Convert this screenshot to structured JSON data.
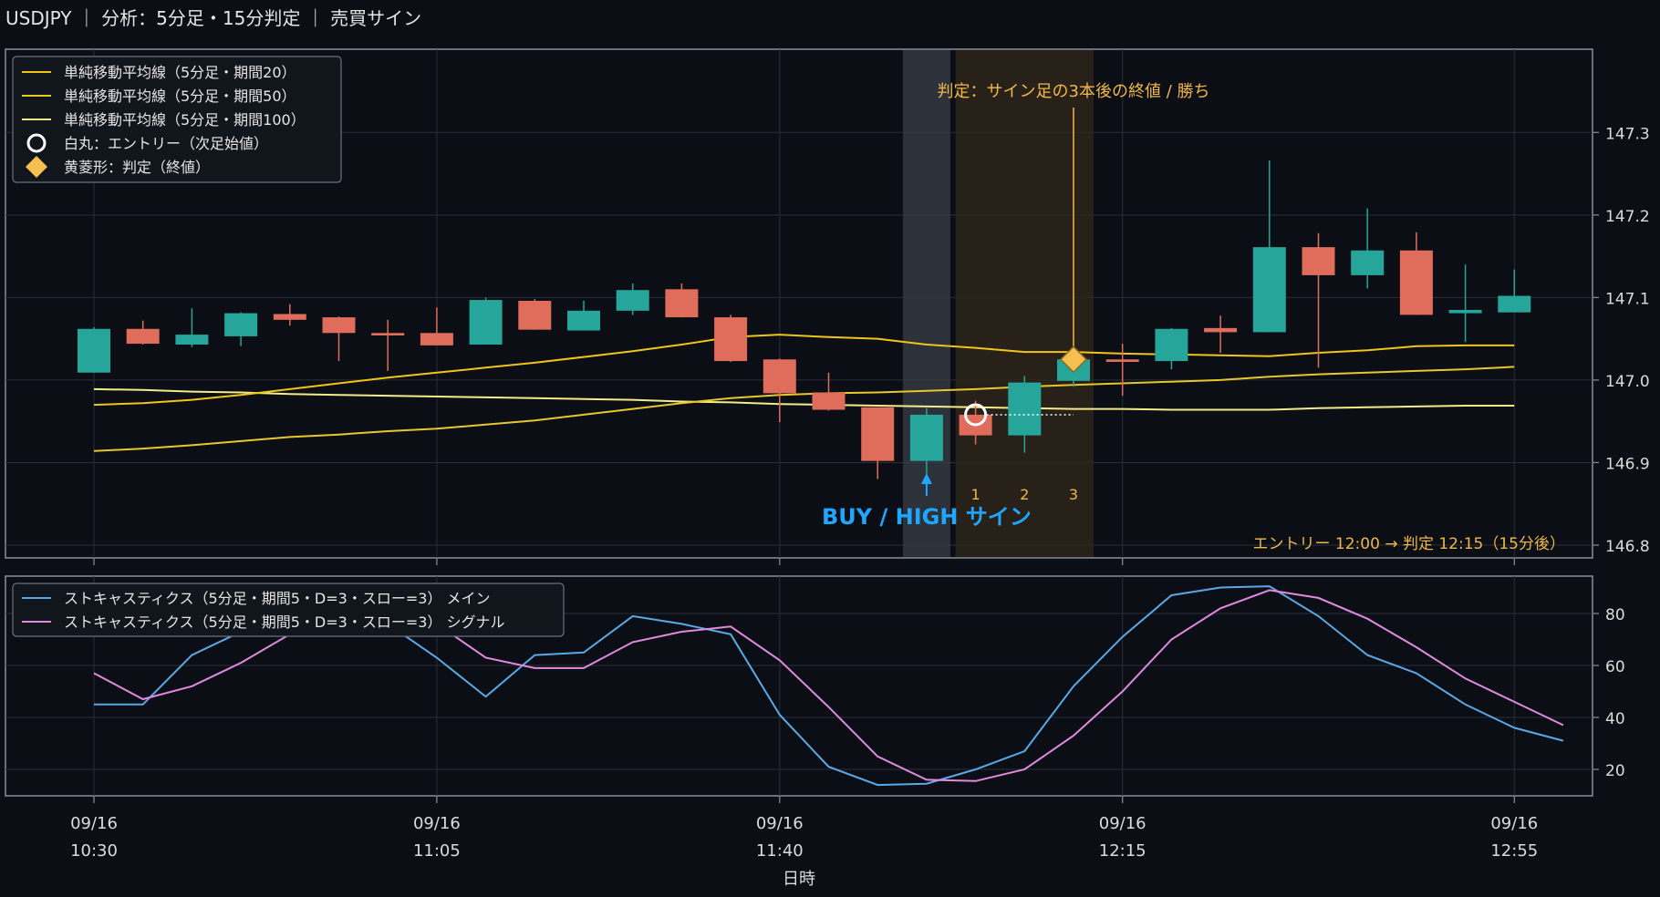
{
  "title": "USDJPY ｜ 分析：5分足・15分判定 ｜ 売買サイン",
  "colors": {
    "background": "#0b0e14",
    "panel_border": "#8a8f99",
    "grid": "#2a2e37",
    "bull": "#26a69a",
    "bear": "#e06c5c",
    "sma20": "#f0c419",
    "sma50": "#e8c72a",
    "sma100": "#f3ea8a",
    "judge_marker": "#f6bf4f",
    "sign_text": "#1fa6ff",
    "stoch_main": "#5aa9e6",
    "stoch_signal": "#e28adf",
    "annotation": "#f0b84a"
  },
  "chart_data": [
    {
      "type": "candlestick",
      "symbol": "USDJPY",
      "timeframe": "5分足",
      "ylim": [
        146.8,
        147.35
      ],
      "yticks": [
        146.8,
        146.9,
        147.0,
        147.1,
        147.2,
        147.3
      ],
      "ytick_labels": [
        "146.8",
        "146.9",
        "147.0",
        "147.1",
        "147.2",
        "147.3"
      ],
      "grid": true,
      "legend_position": "top-left",
      "legend": [
        {
          "label": "単純移動平均線（5分足・期間20）",
          "kind": "line",
          "color": "#f0c419"
        },
        {
          "label": "単純移動平均線（5分足・期間50）",
          "kind": "line",
          "color": "#e8c72a"
        },
        {
          "label": "単純移動平均線（5分足・期間100）",
          "kind": "line",
          "color": "#f3ea8a"
        },
        {
          "label": "白丸：エントリー（次足始値）",
          "kind": "circle",
          "color": "#ffffff"
        },
        {
          "label": "黄菱形：判定（終値）",
          "kind": "diamond",
          "color": "#f6bf4f"
        }
      ],
      "times": [
        "10:30",
        "10:35",
        "10:40",
        "10:45",
        "10:50",
        "10:55",
        "11:00",
        "11:05",
        "11:10",
        "11:15",
        "11:20",
        "11:25",
        "11:30",
        "11:35",
        "11:40",
        "11:45",
        "11:50",
        "11:55",
        "12:00",
        "12:05",
        "12:10",
        "12:15",
        "12:20",
        "12:25",
        "12:30",
        "12:35",
        "12:40",
        "12:45",
        "12:50",
        "12:55"
      ],
      "candles": [
        {
          "o": 147.009,
          "h": 147.064,
          "l": 147.009,
          "c": 147.062
        },
        {
          "o": 147.062,
          "h": 147.072,
          "l": 147.043,
          "c": 147.044
        },
        {
          "o": 147.043,
          "h": 147.087,
          "l": 147.04,
          "c": 147.055
        },
        {
          "o": 147.053,
          "h": 147.082,
          "l": 147.041,
          "c": 147.081
        },
        {
          "o": 147.08,
          "h": 147.092,
          "l": 147.066,
          "c": 147.073
        },
        {
          "o": 147.076,
          "h": 147.077,
          "l": 147.023,
          "c": 147.057
        },
        {
          "o": 147.057,
          "h": 147.073,
          "l": 147.011,
          "c": 147.054
        },
        {
          "o": 147.057,
          "h": 147.088,
          "l": 147.042,
          "c": 147.042
        },
        {
          "o": 147.043,
          "h": 147.1,
          "l": 147.043,
          "c": 147.097
        },
        {
          "o": 147.096,
          "h": 147.098,
          "l": 147.061,
          "c": 147.061
        },
        {
          "o": 147.06,
          "h": 147.096,
          "l": 147.06,
          "c": 147.084
        },
        {
          "o": 147.084,
          "h": 147.117,
          "l": 147.079,
          "c": 147.109
        },
        {
          "o": 147.11,
          "h": 147.117,
          "l": 147.076,
          "c": 147.076
        },
        {
          "o": 147.076,
          "h": 147.079,
          "l": 147.022,
          "c": 147.023
        },
        {
          "o": 147.025,
          "h": 147.026,
          "l": 146.949,
          "c": 146.984
        },
        {
          "o": 146.985,
          "h": 147.009,
          "l": 146.963,
          "c": 146.964
        },
        {
          "o": 146.967,
          "h": 146.967,
          "l": 146.88,
          "c": 146.902
        },
        {
          "o": 146.902,
          "h": 146.966,
          "l": 146.886,
          "c": 146.958
        },
        {
          "o": 146.958,
          "h": 146.975,
          "l": 146.922,
          "c": 146.933
        },
        {
          "o": 146.933,
          "h": 147.005,
          "l": 146.912,
          "c": 146.997
        },
        {
          "o": 146.999,
          "h": 147.028,
          "l": 146.992,
          "c": 147.025
        },
        {
          "o": 147.025,
          "h": 147.044,
          "l": 146.981,
          "c": 147.022
        },
        {
          "o": 147.023,
          "h": 147.063,
          "l": 147.013,
          "c": 147.062
        },
        {
          "o": 147.063,
          "h": 147.078,
          "l": 147.033,
          "c": 147.058
        },
        {
          "o": 147.058,
          "h": 147.266,
          "l": 147.058,
          "c": 147.161
        },
        {
          "o": 147.161,
          "h": 147.178,
          "l": 147.015,
          "c": 147.127
        },
        {
          "o": 147.127,
          "h": 147.208,
          "l": 147.111,
          "c": 147.157
        },
        {
          "o": 147.157,
          "h": 147.179,
          "l": 147.079,
          "c": 147.079
        },
        {
          "o": 147.081,
          "h": 147.14,
          "l": 147.046,
          "c": 147.085
        },
        {
          "o": 147.082,
          "h": 147.134,
          "l": 147.082,
          "c": 147.102
        }
      ],
      "sma20": [
        146.97,
        146.972,
        146.976,
        146.982,
        146.989,
        146.996,
        147.003,
        147.009,
        147.015,
        147.021,
        147.028,
        147.035,
        147.043,
        147.052,
        147.055,
        147.052,
        147.05,
        147.043,
        147.039,
        147.034,
        147.034,
        147.032,
        147.031,
        147.03,
        147.029,
        147.033,
        147.036,
        147.041,
        147.042,
        147.042
      ],
      "sma50": [
        146.914,
        146.917,
        146.921,
        146.926,
        146.931,
        146.934,
        146.938,
        146.941,
        146.946,
        146.951,
        146.958,
        146.965,
        146.972,
        146.978,
        146.982,
        146.984,
        146.985,
        146.987,
        146.989,
        146.992,
        146.994,
        146.996,
        146.998,
        147.0,
        147.004,
        147.007,
        147.009,
        147.011,
        147.013,
        147.016
      ],
      "sma100": [
        146.989,
        146.988,
        146.986,
        146.985,
        146.983,
        146.982,
        146.981,
        146.98,
        146.979,
        146.978,
        146.977,
        146.976,
        146.974,
        146.973,
        146.971,
        146.97,
        146.969,
        146.968,
        146.967,
        146.966,
        146.965,
        146.965,
        146.964,
        146.964,
        146.964,
        146.966,
        146.967,
        146.968,
        146.969,
        146.969
      ],
      "signal": {
        "index": 17,
        "text": "BUY / HIGH サイン"
      },
      "entry": {
        "index": 18,
        "price": 146.958,
        "time": "12:00"
      },
      "judge": {
        "index": 20,
        "price": 147.025,
        "time": "12:15"
      },
      "count_labels": [
        "1",
        "2",
        "3"
      ],
      "judge_text": "判定：サイン足の3本後の終値 / 勝ち",
      "entry_judge_text": "エントリー 12:00 → 判定 12:15（15分後）"
    },
    {
      "type": "line",
      "name": "stochastics",
      "ylim": [
        10,
        93
      ],
      "yticks": [
        20,
        40,
        60,
        80
      ],
      "ytick_labels": [
        "20",
        "40",
        "60",
        "80"
      ],
      "grid": true,
      "legend_position": "top-left",
      "series": [
        {
          "name": "ストキャスティクス（5分足・期間5・D=3・スロー=3） メイン",
          "color": "#5aa9e6",
          "values": [
            45,
            45,
            64,
            73,
            76,
            76,
            76,
            63,
            48,
            64,
            65,
            79,
            76,
            72,
            41,
            21,
            14,
            14.5,
            20,
            27,
            52,
            71,
            87,
            90,
            90.5,
            79,
            64,
            57,
            45,
            36,
            31
          ]
        },
        {
          "name": "ストキャスティクス（5分足・期間5・D=3・スロー=3） シグナル",
          "color": "#e28adf",
          "values": [
            57,
            47,
            52,
            61,
            72,
            75,
            75,
            76,
            63,
            59,
            59,
            69,
            73,
            75,
            62,
            44,
            25,
            16,
            15.5,
            20,
            33,
            50,
            70,
            82,
            89,
            86,
            78,
            67,
            55,
            46,
            37
          ]
        }
      ]
    }
  ],
  "x_axis": {
    "label": "日時",
    "ticks": [
      {
        "index": 0,
        "date": "09/16",
        "time": "10:30"
      },
      {
        "index": 7,
        "date": "09/16",
        "time": "11:05"
      },
      {
        "index": 14,
        "date": "09/16",
        "time": "11:40"
      },
      {
        "index": 21,
        "date": "09/16",
        "time": "12:15"
      },
      {
        "index": 29,
        "date": "09/16",
        "time": "12:55"
      }
    ]
  }
}
